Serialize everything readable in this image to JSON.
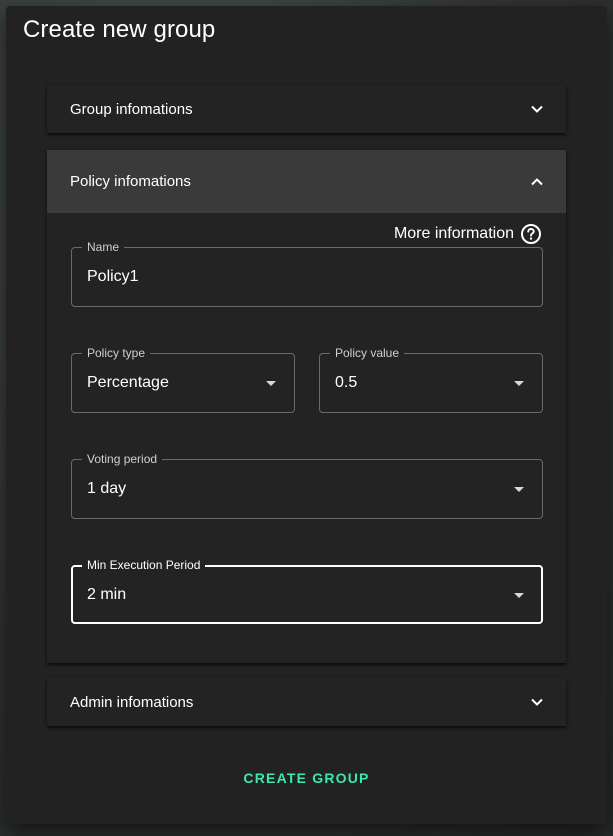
{
  "dialog": {
    "title": "Create new group"
  },
  "sections": {
    "group": {
      "label": "Group infomations",
      "expanded": false
    },
    "policy": {
      "label": "Policy infomations",
      "expanded": true
    },
    "admin": {
      "label": "Admin infomations",
      "expanded": false
    }
  },
  "policy": {
    "more_info_label": "More information",
    "name": {
      "label": "Name",
      "value": "Policy1"
    },
    "policy_type": {
      "label": "Policy type",
      "value": "Percentage"
    },
    "policy_value": {
      "label": "Policy value",
      "value": "0.5"
    },
    "voting_period": {
      "label": "Voting period",
      "value": "1 day"
    },
    "min_execution_period": {
      "label": "Min Execution Period",
      "value": "2 min"
    }
  },
  "actions": {
    "create_label": "CREATE GROUP"
  },
  "colors": {
    "accent": "#3ee6b0",
    "dialog_bg": "#222222",
    "expanded_header_bg": "#3a3a3a"
  },
  "icons": {
    "expand": "chevron-down-icon",
    "collapse": "chevron-up-icon",
    "help": "help-circle-icon",
    "dropdown": "dropdown-arrow-icon"
  }
}
